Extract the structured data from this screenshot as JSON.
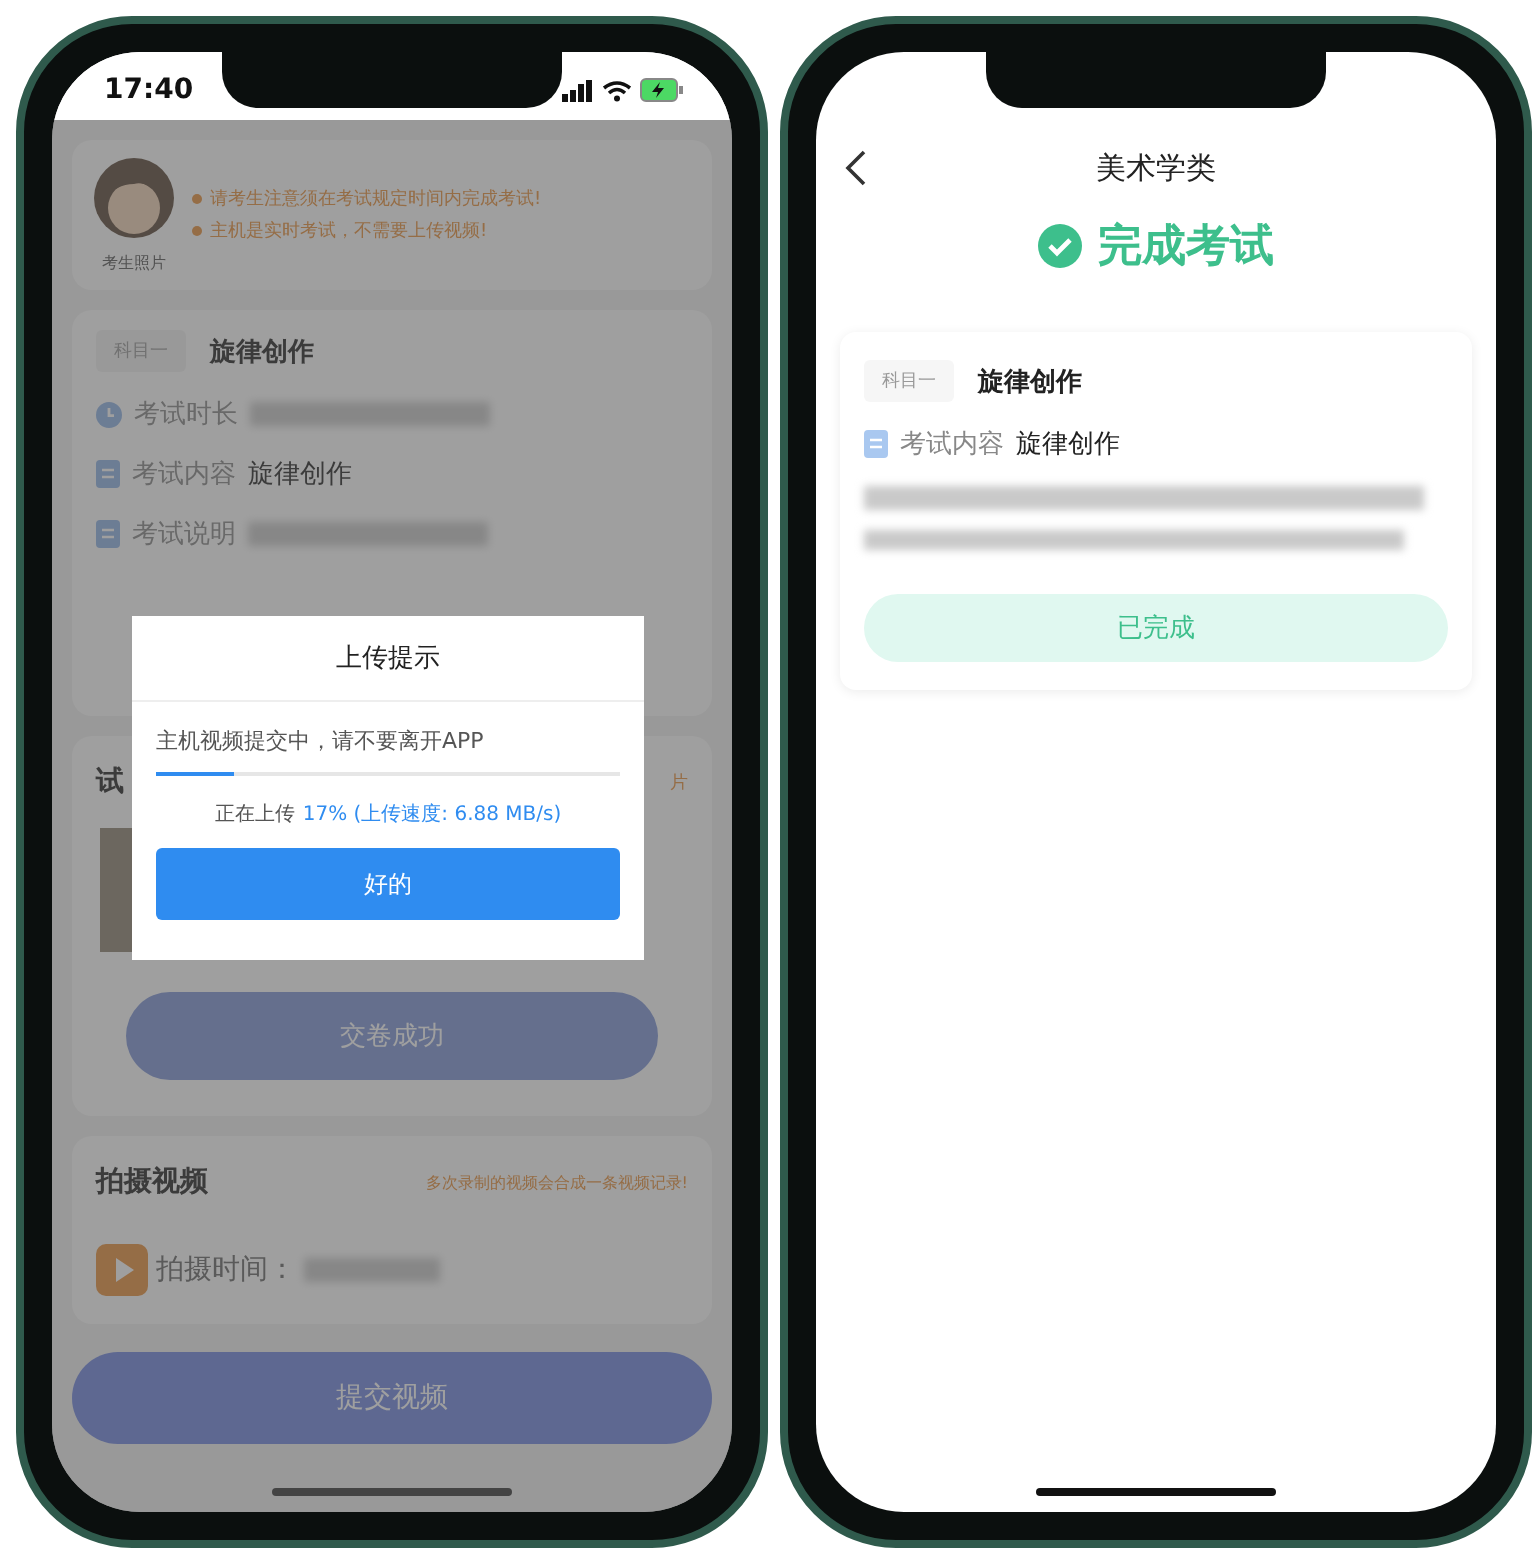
{
  "left_phone": {
    "status_bar": {
      "time": "17:40"
    },
    "notice": {
      "photo_label": "考生照片",
      "tips": [
        "请考生注意须在考试规定时间内完成考试!",
        "主机是实时考试，不需要上传视频!"
      ]
    },
    "subject": {
      "tag": "科目一",
      "name": "旋律创作",
      "rows": [
        {
          "kind": "clock",
          "label": "考试时长"
        },
        {
          "kind": "doc",
          "label": "考试内容",
          "value": "旋律创作"
        },
        {
          "kind": "doc",
          "label": "考试说明"
        }
      ]
    },
    "paper": {
      "title_fragment": "试",
      "hint_fragment": "片",
      "state_button": "交卷成功"
    },
    "video": {
      "title": "拍摄视频",
      "hint": "多次录制的视频会合成一条视频记录!",
      "time_label": "拍摄时间："
    },
    "submit_video_button": "提交视频",
    "dialog": {
      "title": "上传提示",
      "message": "主机视频提交中，请不要离开APP",
      "level": 0.17,
      "status_prefix": "正在上传",
      "status_value": "17% (上传速度: 6.88 MB/s)",
      "button": "好的"
    }
  },
  "right_phone": {
    "nav_title": "美术学类",
    "result": "完成考试",
    "card": {
      "tag": "科目一",
      "name": "旋律创作",
      "content_label": "考试内容",
      "content_value": "旋律创作",
      "status_button": "已完成"
    }
  }
}
